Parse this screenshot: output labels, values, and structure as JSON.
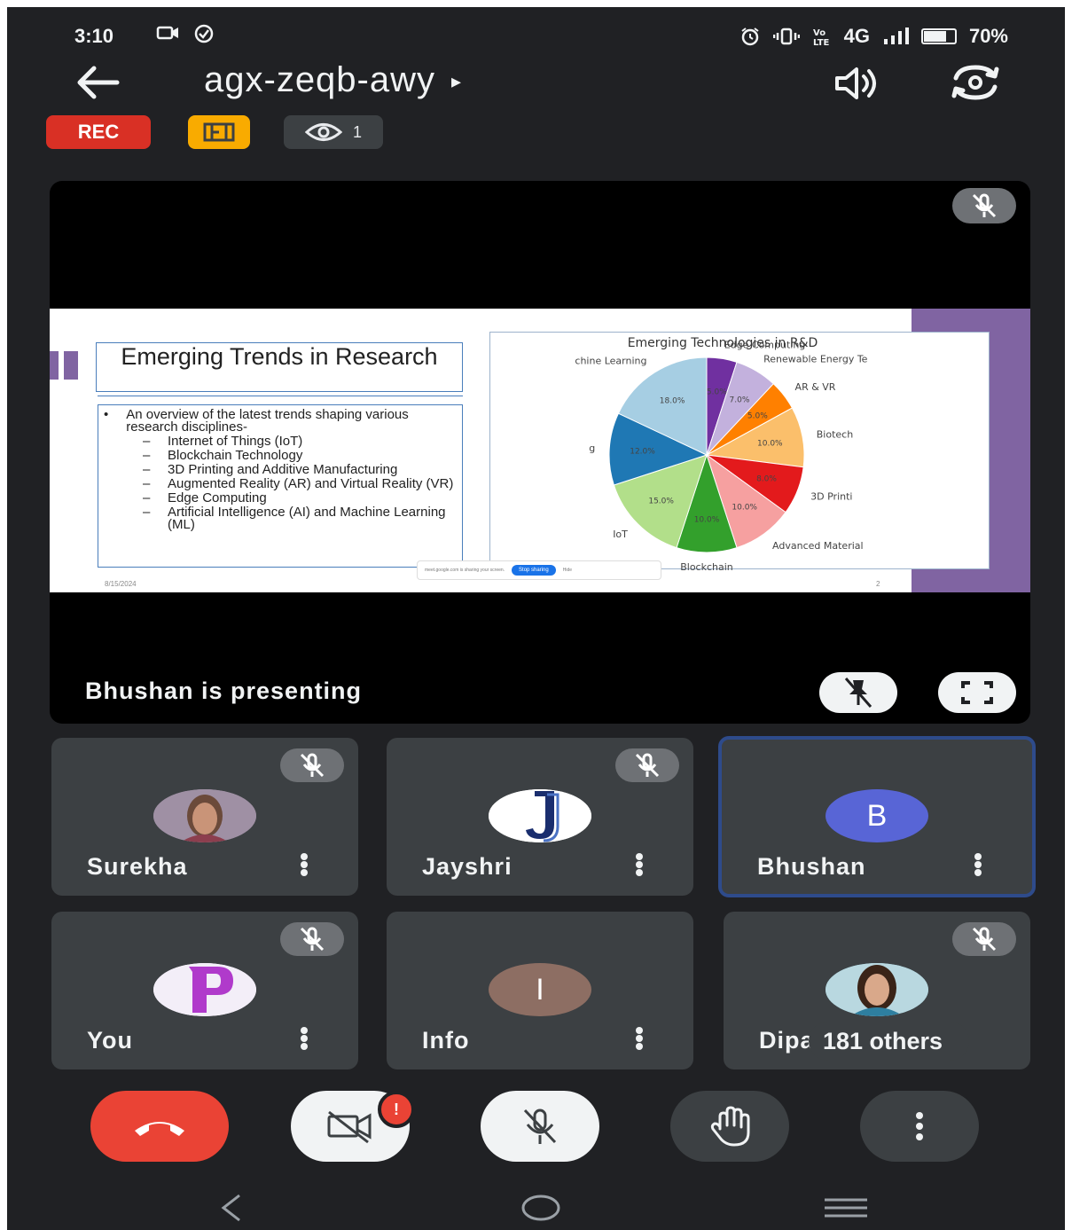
{
  "status_bar": {
    "time": "3:10",
    "network": "4G",
    "battery": "70%",
    "battery_level": 0.7,
    "icons": [
      "camera-icon",
      "check-circle-icon",
      "alarm-icon",
      "vibrate-icon",
      "volte-icon",
      "signal-icon",
      "battery-icon"
    ]
  },
  "header": {
    "meeting_code": "agx-zeqb-awy",
    "dropdown_glyph": "▸",
    "rec_label": "REC",
    "viewer_count": "1",
    "icons": [
      "back-arrow-icon",
      "speaker-icon",
      "switch-camera-icon",
      "host-controls-icon",
      "eye-icon"
    ]
  },
  "presentation": {
    "presenting_text": "Bhushan is presenting",
    "slide": {
      "title": "Emerging Trends in Research",
      "intro": "An overview of the latest trends shaping various research disciplines-",
      "bullets": [
        "Internet of Things (IoT)",
        "Blockchain Technology",
        "3D Printing and Additive Manufacturing",
        "Augmented Reality (AR) and Virtual Reality (VR)",
        "Edge Computing",
        "Artificial Intelligence (AI) and Machine Learning (ML)"
      ],
      "date": "8/15/2024",
      "page": "2",
      "share_bar_text": "meet.google.com is sharing your screen.",
      "share_bar_button": "Stop sharing",
      "share_bar_hide": "Hide"
    }
  },
  "chart_data": {
    "type": "pie",
    "title": "Emerging Technologies in R&D",
    "slices": [
      {
        "label": "Edge Computing",
        "value": 5.0,
        "display": "5.0%",
        "color": "#7030a0"
      },
      {
        "label": "Renewable Energy Te",
        "value": 7.0,
        "display": "7.0%",
        "color": "#c3b1dd"
      },
      {
        "label": "AR & VR",
        "value": 5.0,
        "display": "5.0%",
        "color": "#ff8000"
      },
      {
        "label": "Biotech",
        "value": 10.0,
        "display": "10.0%",
        "color": "#fbbf6b"
      },
      {
        "label": "3D Printi",
        "value": 8.0,
        "display": "8.0%",
        "color": "#e31a1c"
      },
      {
        "label": "Advanced Material",
        "value": 10.0,
        "display": "10.0%",
        "color": "#f6a0a0"
      },
      {
        "label": "Blockchain",
        "value": 10.0,
        "display": "10.0%",
        "color": "#33a02c"
      },
      {
        "label": "IoT",
        "value": 15.0,
        "display": "15.0%",
        "color": "#b2df8a"
      },
      {
        "label": "g",
        "value": 12.0,
        "display": "12.0%",
        "color": "#1f78b4"
      },
      {
        "label": "chine Learning",
        "value": 18.0,
        "display": "18.0%",
        "color": "#a6cee3"
      }
    ]
  },
  "participants": [
    {
      "name": "Surekha",
      "muted": true,
      "avatar_type": "photo",
      "avatar_color": "#8a7a8a"
    },
    {
      "name": "Jayshri",
      "muted": true,
      "avatar_type": "letter-logo",
      "avatar_letter": "J",
      "avatar_color": "#ffffff"
    },
    {
      "name": "Bhushan",
      "muted": false,
      "avatar_type": "letter",
      "avatar_letter": "B",
      "avatar_color": "#5865d6",
      "active_speaker": true
    },
    {
      "name": "You",
      "muted": true,
      "avatar_type": "letter-logo",
      "avatar_letter": "P",
      "avatar_color": "#f3eef8"
    },
    {
      "name": "Info",
      "muted": false,
      "avatar_type": "letter",
      "avatar_letter": "I",
      "avatar_color": "#8d6e63"
    },
    {
      "name": "Dipa",
      "muted": true,
      "avatar_type": "photo",
      "avatar_color": "#7ab8c9",
      "others_label": "181 others"
    }
  ],
  "controls": {
    "icons": [
      "end-call-icon",
      "camera-off-icon",
      "mic-off-icon",
      "raise-hand-icon",
      "more-options-icon"
    ],
    "camera_alert": "!"
  },
  "nav_bar": {
    "icons": [
      "nav-back-icon",
      "nav-home-icon",
      "nav-recents-icon"
    ]
  }
}
